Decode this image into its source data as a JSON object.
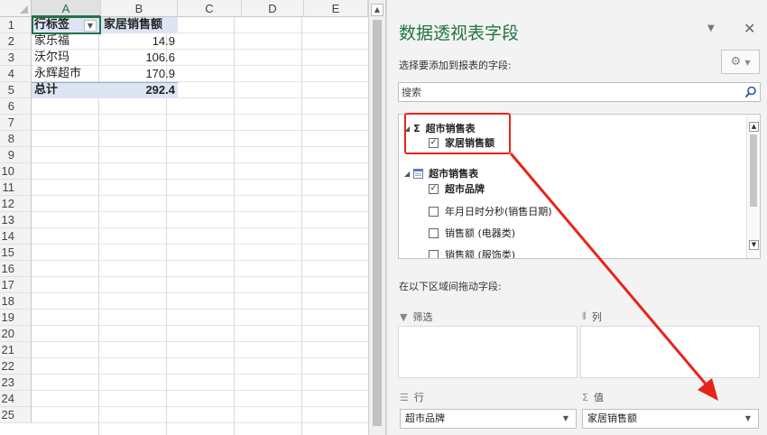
{
  "sheet": {
    "columns": [
      "A",
      "B",
      "C",
      "D",
      "E"
    ],
    "rows": [
      "1",
      "2",
      "3",
      "4",
      "5",
      "6",
      "7",
      "8",
      "9",
      "10",
      "11",
      "12",
      "13",
      "14",
      "15",
      "16",
      "17",
      "18",
      "19",
      "20",
      "21",
      "22",
      "23",
      "24",
      "25"
    ],
    "pivot": {
      "row_header": "行标签",
      "value_header": "家居销售额",
      "rows": [
        {
          "label": "家乐福",
          "value": "14.9"
        },
        {
          "label": "沃尔玛",
          "value": "106.6"
        },
        {
          "label": "永辉超市",
          "value": "170.9"
        }
      ],
      "total_label": "总计",
      "total_value": "292.4"
    }
  },
  "pane": {
    "title": "数据透视表字段",
    "hint": "选择要添加到报表的字段:",
    "search_placeholder": "搜索",
    "tables": [
      {
        "name": "超市销售表",
        "kind": "sigma",
        "fields": [
          {
            "label": "家居销售额",
            "checked": true,
            "bold": true
          }
        ]
      },
      {
        "name": "超市销售表",
        "kind": "table",
        "fields": [
          {
            "label": "超市品牌",
            "checked": true,
            "bold": true
          },
          {
            "label": "年月日时分秒(销售日期)",
            "checked": false,
            "bold": false
          },
          {
            "label": "销售额 (电器类)",
            "checked": false,
            "bold": false
          },
          {
            "label": "销售额 (服饰类)",
            "checked": false,
            "bold": false
          }
        ]
      }
    ],
    "areas_hint": "在以下区域间拖动字段:",
    "areas": {
      "filter": {
        "label": "筛选"
      },
      "columns": {
        "label": "列"
      },
      "rows": {
        "label": "行",
        "item": "超市品牌"
      },
      "values": {
        "label": "值",
        "item": "家居销售额"
      }
    }
  },
  "annotation_color": "#e8231a"
}
